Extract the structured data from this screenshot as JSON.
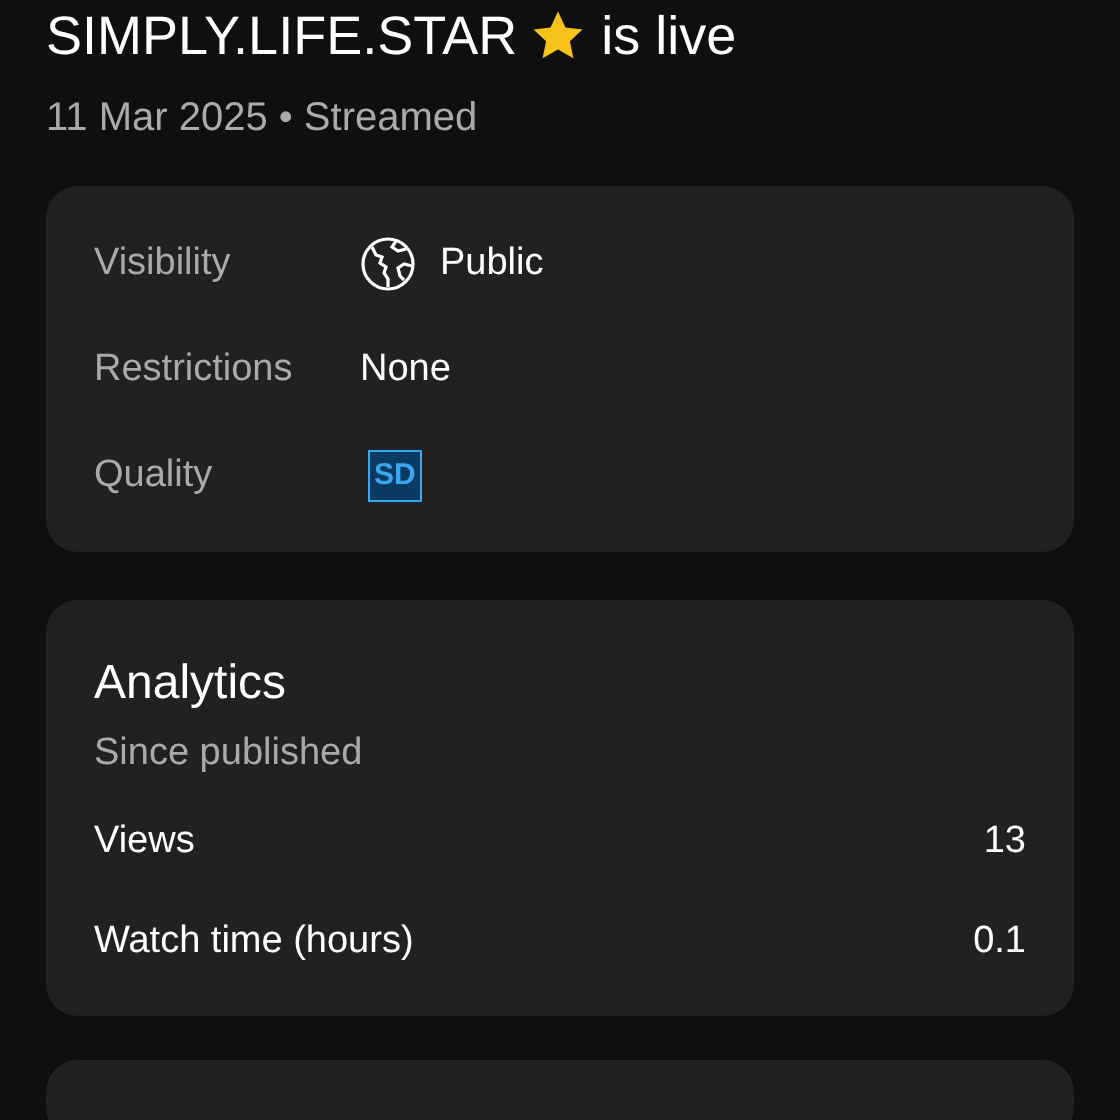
{
  "title": {
    "text": "SIMPLY.LIFE.STAR",
    "suffix": "is live"
  },
  "subtitle": "11 Mar 2025 • Streamed",
  "details": [
    {
      "label": "Visibility",
      "kind": "globe",
      "value": "Public"
    },
    {
      "label": "Restrictions",
      "kind": "text",
      "value": "None"
    },
    {
      "label": "Quality",
      "kind": "badge",
      "value": "SD"
    }
  ],
  "analytics": {
    "title": "Analytics",
    "subtitle": "Since published",
    "rows": [
      {
        "label": "Views",
        "value": "13"
      },
      {
        "label": "Watch time (hours)",
        "value": "0.1"
      }
    ]
  }
}
